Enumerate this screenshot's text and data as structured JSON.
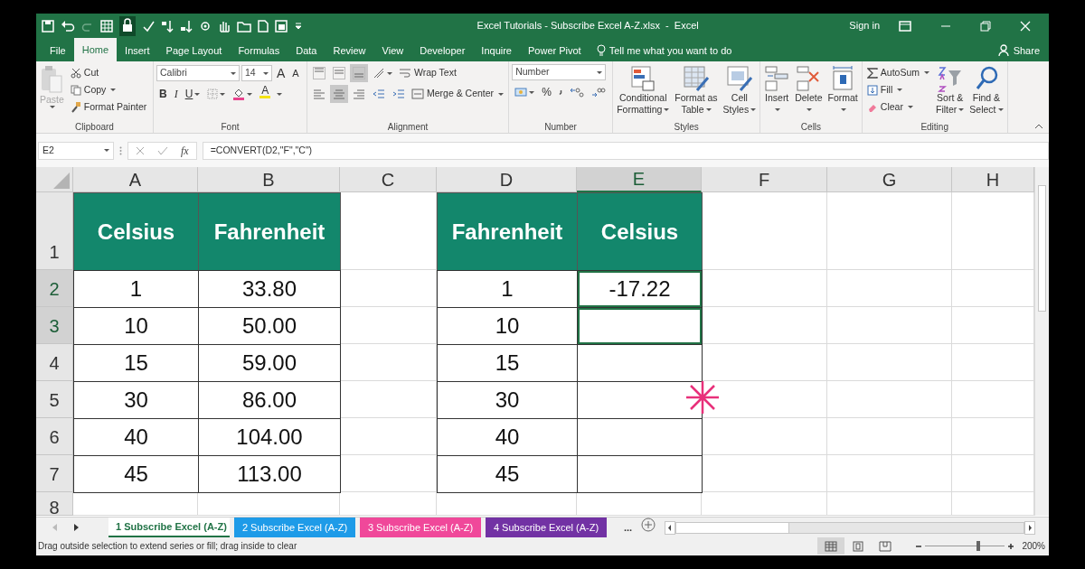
{
  "title_bar": {
    "title": "Excel Tutorials - Subscribe Excel A-Z.xlsx  -  Excel",
    "sign_in": "Sign in"
  },
  "tabs": [
    {
      "label": "File",
      "selected": false
    },
    {
      "label": "Home",
      "selected": true
    },
    {
      "label": "Insert",
      "selected": false
    },
    {
      "label": "Page Layout",
      "selected": false
    },
    {
      "label": "Formulas",
      "selected": false
    },
    {
      "label": "Data",
      "selected": false
    },
    {
      "label": "Review",
      "selected": false
    },
    {
      "label": "View",
      "selected": false
    },
    {
      "label": "Developer",
      "selected": false
    },
    {
      "label": "Inquire",
      "selected": false
    },
    {
      "label": "Power Pivot",
      "selected": false
    }
  ],
  "tell_me": "Tell me what you want to do",
  "share": "Share",
  "ribbon": {
    "clipboard": {
      "label": "Clipboard",
      "paste": {
        "label": "Paste",
        "disabled": true
      },
      "cut": "Cut",
      "copy": "Copy",
      "format_painter": "Format Painter"
    },
    "font": {
      "label": "Font",
      "font_name": "Calibri",
      "font_size": "14",
      "grow": "A",
      "shrink": "A",
      "bold": "B",
      "italic": "I",
      "underline": "U",
      "font_color": "A"
    },
    "alignment": {
      "label": "Alignment",
      "vertical_align": [
        {
          "selected": false
        },
        {
          "selected": false
        },
        {
          "selected": true
        }
      ],
      "horizontal_align": [
        {
          "selected": false
        },
        {
          "selected": true
        },
        {
          "selected": false
        }
      ],
      "wrap_text": "Wrap Text",
      "merge_center": "Merge & Center"
    },
    "number": {
      "label": "Number",
      "format": "Number",
      "percent": "%"
    },
    "styles": {
      "label": "Styles",
      "buttons": [
        {
          "lines": [
            "Conditional",
            "Formatting"
          ]
        },
        {
          "lines": [
            "Format as",
            "Table"
          ]
        },
        {
          "lines": [
            "Cell",
            "Styles"
          ]
        }
      ]
    },
    "cells": {
      "label": "Cells",
      "buttons": [
        {
          "lines": [
            "Insert"
          ]
        },
        {
          "lines": [
            "Delete"
          ]
        },
        {
          "lines": [
            "Format"
          ]
        }
      ]
    },
    "editing": {
      "label": "Editing",
      "autosum": "AutoSum",
      "fill": "Fill",
      "clear": "Clear",
      "sort_filter": [
        "Sort &",
        "Filter"
      ],
      "find_select": [
        "Find &",
        "Select"
      ]
    }
  },
  "formula_bar": {
    "name_box": "E2",
    "function_label": "fx",
    "formula": "=CONVERT(D2,\"F\",\"C\")"
  },
  "columns": [
    {
      "label": "A",
      "selected": false
    },
    {
      "label": "B",
      "selected": false
    },
    {
      "label": "C",
      "selected": false
    },
    {
      "label": "D",
      "selected": false
    },
    {
      "label": "E",
      "selected": true
    },
    {
      "label": "F",
      "selected": false
    },
    {
      "label": "G",
      "selected": false
    },
    {
      "label": "H",
      "selected": false
    }
  ],
  "rows": [
    {
      "header": "1",
      "selected": false,
      "cells": [
        {
          "kind": "header",
          "text": "Celsius",
          "selected": false
        },
        {
          "kind": "header",
          "text": "Fahrenheit",
          "selected": false
        },
        {
          "kind": "blank",
          "selected": false
        },
        {
          "kind": "header",
          "text": "Fahrenheit",
          "selected": false
        },
        {
          "kind": "header",
          "text": "Celsius",
          "selected": false
        },
        {
          "kind": "blank",
          "selected": false
        },
        {
          "kind": "blank",
          "selected": false
        },
        {
          "kind": "blank",
          "selected": false
        }
      ]
    },
    {
      "header": "2",
      "selected": true,
      "cells": [
        {
          "kind": "data",
          "text": "1",
          "selected": false
        },
        {
          "kind": "data",
          "text": "33.80",
          "selected": false
        },
        {
          "kind": "blank",
          "selected": false
        },
        {
          "kind": "data",
          "text": "1",
          "selected": false
        },
        {
          "kind": "data",
          "text": "-17.22",
          "selected": true
        },
        {
          "kind": "blank",
          "selected": false
        },
        {
          "kind": "blank",
          "selected": false
        },
        {
          "kind": "blank",
          "selected": false
        }
      ]
    },
    {
      "header": "3",
      "selected": true,
      "cells": [
        {
          "kind": "data",
          "text": "10",
          "selected": false
        },
        {
          "kind": "data",
          "text": "50.00",
          "selected": false
        },
        {
          "kind": "blank",
          "selected": false
        },
        {
          "kind": "data",
          "text": "10",
          "selected": false
        },
        {
          "kind": "data",
          "selected": true
        },
        {
          "kind": "blank",
          "selected": false
        },
        {
          "kind": "blank",
          "selected": false
        },
        {
          "kind": "blank",
          "selected": false
        }
      ]
    },
    {
      "header": "4",
      "selected": false,
      "cells": [
        {
          "kind": "data",
          "text": "15",
          "selected": false
        },
        {
          "kind": "data",
          "text": "59.00",
          "selected": false
        },
        {
          "kind": "blank",
          "selected": false
        },
        {
          "kind": "data",
          "text": "15",
          "selected": false
        },
        {
          "kind": "data",
          "selected": false
        },
        {
          "kind": "blank",
          "selected": false
        },
        {
          "kind": "blank",
          "selected": false
        },
        {
          "kind": "blank",
          "selected": false
        }
      ]
    },
    {
      "header": "5",
      "selected": false,
      "cells": [
        {
          "kind": "data",
          "text": "30",
          "selected": false
        },
        {
          "kind": "data",
          "text": "86.00",
          "selected": false
        },
        {
          "kind": "blank",
          "selected": false
        },
        {
          "kind": "data",
          "text": "30",
          "selected": false
        },
        {
          "kind": "data",
          "selected": false
        },
        {
          "kind": "blank",
          "selected": false
        },
        {
          "kind": "blank",
          "selected": false
        },
        {
          "kind": "blank",
          "selected": false
        }
      ]
    },
    {
      "header": "6",
      "selected": false,
      "cells": [
        {
          "kind": "data",
          "text": "40",
          "selected": false
        },
        {
          "kind": "data",
          "text": "104.00",
          "selected": false
        },
        {
          "kind": "blank",
          "selected": false
        },
        {
          "kind": "data",
          "text": "40",
          "selected": false
        },
        {
          "kind": "data",
          "selected": false
        },
        {
          "kind": "blank",
          "selected": false
        },
        {
          "kind": "blank",
          "selected": false
        },
        {
          "kind": "blank",
          "selected": false
        }
      ]
    },
    {
      "header": "7",
      "selected": false,
      "cells": [
        {
          "kind": "data",
          "text": "45",
          "selected": false
        },
        {
          "kind": "data",
          "text": "113.00",
          "selected": false
        },
        {
          "kind": "blank",
          "selected": false
        },
        {
          "kind": "data",
          "text": "45",
          "selected": false
        },
        {
          "kind": "data",
          "selected": false
        },
        {
          "kind": "blank",
          "selected": false
        },
        {
          "kind": "blank",
          "selected": false
        },
        {
          "kind": "blank",
          "selected": false
        }
      ]
    },
    {
      "header": "8",
      "selected": false,
      "cells": [
        {
          "kind": "blank",
          "selected": false
        },
        {
          "kind": "blank",
          "selected": false
        },
        {
          "kind": "blank",
          "selected": false
        },
        {
          "kind": "blank",
          "selected": false
        },
        {
          "kind": "blank",
          "selected": false
        },
        {
          "kind": "blank",
          "selected": false
        },
        {
          "kind": "blank",
          "selected": false
        },
        {
          "kind": "blank",
          "selected": false
        }
      ]
    }
  ],
  "sheet_tabs": [
    {
      "label": "1 Subscribe Excel (A-Z)",
      "selected": true
    },
    {
      "label": "2 Subscribe Excel (A-Z)",
      "selected": false,
      "color": "#1e9be8"
    },
    {
      "label": "3 Subscribe Excel (A-Z)",
      "selected": false,
      "color": "#f0489a"
    },
    {
      "label": "4 Subscribe Excel (A-Z)",
      "selected": false,
      "color": "#7232a4"
    }
  ],
  "more_sheets": "...",
  "status_bar": {
    "message": "Drag outside selection to extend series or fill; drag inside to clear",
    "views": [
      {
        "selected": true
      },
      {
        "selected": false
      },
      {
        "selected": false
      }
    ],
    "zoom": {
      "level": 0.66,
      "reading": "200%"
    }
  }
}
